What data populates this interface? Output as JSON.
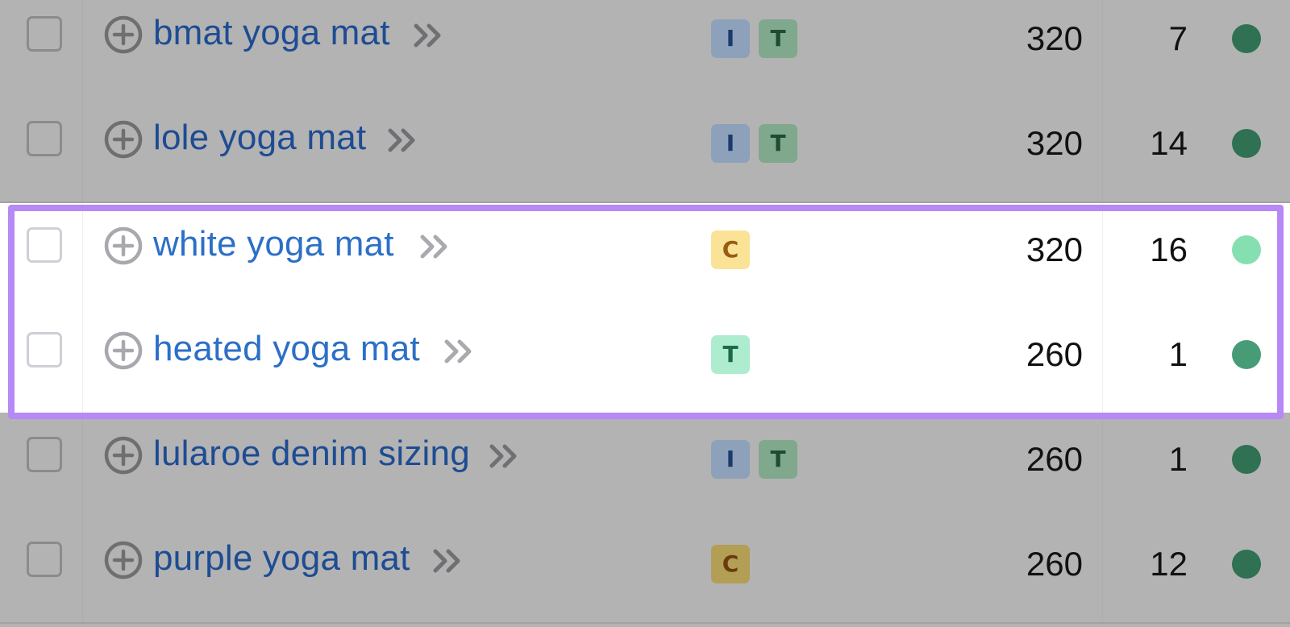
{
  "rows": [
    {
      "keyword": "bmat yoga mat",
      "intents": [
        "I",
        "T"
      ],
      "volume": "320",
      "kd": "7",
      "kd_color": "#2f7152",
      "highlighted": false
    },
    {
      "keyword": "lole yoga mat",
      "intents": [
        "I",
        "T"
      ],
      "volume": "320",
      "kd": "14",
      "kd_color": "#2f7152",
      "highlighted": false
    },
    {
      "keyword": "white yoga mat",
      "intents": [
        "C"
      ],
      "volume": "320",
      "kd": "16",
      "kd_color": "#86dfb0",
      "highlighted": true
    },
    {
      "keyword": "heated yoga mat",
      "intents": [
        "T"
      ],
      "volume": "260",
      "kd": "1",
      "kd_color": "#479c77",
      "highlighted": true
    },
    {
      "keyword": "lularoe denim sizing",
      "intents": [
        "I",
        "T"
      ],
      "volume": "260",
      "kd": "1",
      "kd_color": "#2f7152",
      "highlighted": false
    },
    {
      "keyword": "purple yoga mat",
      "intents": [
        "C"
      ],
      "volume": "260",
      "kd": "12",
      "kd_color": "#2f7152",
      "highlighted": false
    }
  ],
  "icons": {
    "add": "plus-circle-icon",
    "expand": "double-chevron-right-icon"
  },
  "colors": {
    "overlay": "#b3b3b3",
    "highlight_border": "#b788f6",
    "link_active": "#2c6fc7",
    "link_dimmed": "#1d4c93"
  }
}
